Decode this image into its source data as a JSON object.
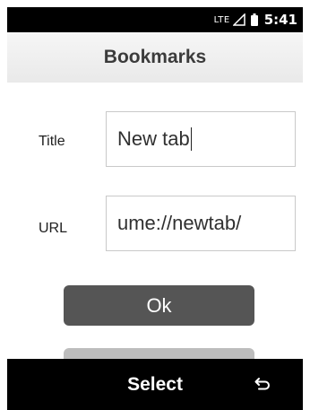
{
  "status_bar": {
    "network": "LTE",
    "time": "5:41",
    "icons": [
      "signal-icon",
      "battery-icon"
    ]
  },
  "header": {
    "title": "Bookmarks"
  },
  "form": {
    "title_label": "Title",
    "title_value": "New tab",
    "url_label": "URL",
    "url_value": "ume://newtab/"
  },
  "buttons": {
    "ok_label": "Ok"
  },
  "softkeys": {
    "center_label": "Select",
    "right_icon": "back-icon"
  },
  "colors": {
    "ok_button": "#555555",
    "bars": "#000000",
    "header": "#efefef"
  }
}
